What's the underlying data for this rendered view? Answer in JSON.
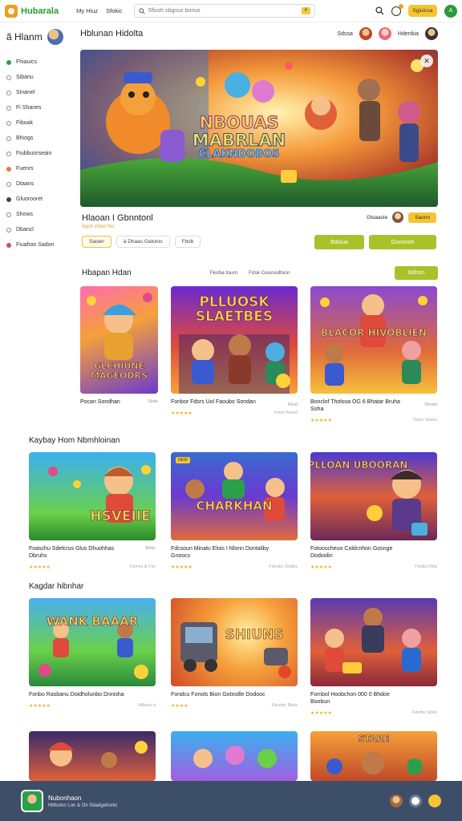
{
  "app": {
    "name": "Hubarala"
  },
  "topbar": {
    "nav": [
      "My Hiuz",
      "Sfokic"
    ],
    "search_placeholder": "Sfiush sbgnuz bonus",
    "search_badge": "4",
    "signin_label": "Sgiuinsa",
    "user_initial": "A"
  },
  "sidebar": {
    "user_name": "ã Hlanm",
    "items": [
      {
        "label": "Fhiauics",
        "icon": "green-dot-icon"
      },
      {
        "label": "Sibanu",
        "icon": "link-icon"
      },
      {
        "label": "Sinanel",
        "icon": "link-icon"
      },
      {
        "label": "Fi Shanes",
        "icon": "link-icon"
      },
      {
        "label": "Fiboak",
        "icon": "link-icon"
      },
      {
        "label": "Bhiogs",
        "icon": "link-icon"
      },
      {
        "label": "Fiubbuorseain",
        "icon": "circle-icon"
      },
      {
        "label": "Fuenrs",
        "icon": "orange-dot-icon"
      },
      {
        "label": "Dtaans",
        "icon": "circle-icon"
      },
      {
        "label": "Gluorooret",
        "icon": "dark-dot-icon"
      },
      {
        "label": "Shows",
        "icon": "circle-icon"
      },
      {
        "label": "Dbancl",
        "icon": "circle-icon"
      },
      {
        "label": "Fiuahoo Sadon",
        "icon": "red-dot-icon"
      }
    ]
  },
  "header": {
    "title": "Hblunan Hidolta",
    "right_label_1": "Sdssa",
    "right_label_2": "Hdenbia"
  },
  "hero": {
    "line1": "NBOUAS",
    "line2": "MABRLAN",
    "line3": "CLAKNDOBOS",
    "title": "Hlaoan I Gbnntonl",
    "subtitle": "Sgoh chom thu",
    "host_label": "Gloaaste",
    "follow_label": "Saono",
    "tags": [
      "Saoen",
      "à Dhaas Gatonio",
      "Fbob"
    ],
    "btn_1": "Bdoiua",
    "btn_2": "Gooonoh"
  },
  "section_1": {
    "title": "Hbapan Hdan",
    "filters": [
      "Fkoha toum",
      "Fdsk Goonodhion"
    ],
    "button": "Bdhon"
  },
  "section_2": {
    "title": "Kaybay Hom Nbmhloinan"
  },
  "section_3": {
    "title": "Kagdar hibnhar"
  },
  "cards": [
    {
      "art": "GLCHIUNE MAGEODRS",
      "name": "Pocan Sondhan",
      "meta": "Sbde",
      "stars": "",
      "count": ""
    },
    {
      "art": "PLLUOSK SLAETBES",
      "name": "Fonbor Fdsrs Uol Faoubo Sondan",
      "meta": "Fbsd",
      "stars": "★★★★★",
      "count": "Fhnto Bioed"
    },
    {
      "art": "BLACOR HIVOBLIEN",
      "name": "Bonclof Tholsoa OG 6 Bhatar Bruha Soha",
      "meta": "Shodo",
      "stars": "★★★★★",
      "count": "Tbms Sbaks"
    },
    {
      "art": "HSVEIIE",
      "name": "Foaschu Sdelcrus Glus Dhuohhas Dbruhs",
      "meta": "Bdds",
      "stars": "★★★★★",
      "count": "Fdmcs & Fss"
    },
    {
      "art": "CHARKHAN",
      "name": "Fdcsoun Minatu Elois I Nlonn Dontaliby Gnoocs",
      "meta": "",
      "stars": "★★★★★",
      "count": "Fdoobc Dodbs"
    },
    {
      "art": "PLLOAN UBOORAN",
      "name": "Fotooscheuo Coldcnhon Gosnge Dodoolin",
      "meta": "",
      "stars": "★★★★★",
      "count": "Fbdbu Fbla"
    },
    {
      "art": "WANK BAAAR",
      "name": "Fonbo Rasbanu Doidholunbo Dnnisha",
      "meta": "",
      "stars": "★★★★★",
      "count": "Hfbsdu b"
    },
    {
      "art": "SHIUNS",
      "name": "Fondcu Fonols Bion Gotxstlle Dodooc",
      "meta": "",
      "stars": "★★★★",
      "count": "Fdoobc Bbds"
    },
    {
      "art": "",
      "name": "Fombol Hoobchon 000 0 Bhdoe Boobun",
      "meta": "",
      "stars": "★★★★★",
      "count": "Fdotbs Sbdo"
    },
    {
      "art": "",
      "name": "",
      "meta": "",
      "stars": "",
      "count": ""
    },
    {
      "art": "",
      "name": "",
      "meta": "",
      "stars": "",
      "count": ""
    },
    {
      "art": "STARE",
      "name": "",
      "meta": "",
      "stars": "",
      "count": ""
    }
  ],
  "bottombar": {
    "title": "Nubonhaon",
    "subtitle": "Hbfoohn Lon & On Sdadgehonic"
  },
  "colors": {
    "brand_green": "#2e9a2e",
    "accent_yellow": "#f5c431",
    "action_green": "#a8c229",
    "footer_bg": "#3d4e68"
  }
}
